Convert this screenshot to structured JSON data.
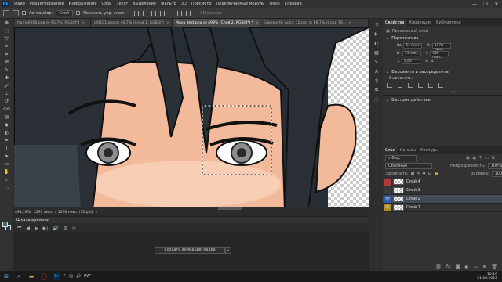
{
  "app": {
    "logo": "Ps"
  },
  "menu": [
    "Файл",
    "Редактирование",
    "Изображение",
    "Слои",
    "Текст",
    "Выделение",
    "Фильтр",
    "3D",
    "Просмотр",
    "Подключаемые модули",
    "Окно",
    "Справка"
  ],
  "window_controls": [
    "—",
    "❐",
    "✕"
  ],
  "options": {
    "autoselect_label": "Автовыбор:",
    "autoselect_value": "Слой",
    "show_controls_label": "Показать упр. элем.",
    "mode_3d": "3D-режим:"
  },
  "tabs": [
    {
      "label": "frame0000.png @ 66,7% (RGB/8*)",
      "close": "×",
      "active": false
    },
    {
      "label": "pl0101.png @ 46,7% (Слой 1, RGB/8*)",
      "close": "×",
      "active": false
    },
    {
      "label": "Maya_test.png @ 498% (Слой 2, RGB/8*) *",
      "close": "×",
      "active": true
    },
    {
      "label": "Edgeworth_point_c2.psd @ 66,7% (Слой 19...",
      "close": "×",
      "active": false
    }
  ],
  "status": {
    "zoom": "498,18%",
    "size": "2293 пикс. x 1290 пикс. (72 ppi)",
    "arrow": "›"
  },
  "timeline": {
    "title": "Шкала времени",
    "create_button": "Создать анимацию кадра",
    "dropdown": "⌄",
    "controls": [
      "⏮",
      "◀",
      "▶",
      "▶|",
      "🔊",
      "⚙",
      "✂"
    ]
  },
  "properties": {
    "tabs": [
      "Свойства",
      "Коррекция",
      "Библиотеки"
    ],
    "pixel_layer": "Пиксельный слой",
    "transform_title": "Перспектива",
    "w_label": "Ш:",
    "w_value": "54 пикс.",
    "h_label": "В:",
    "h_value": "54 пикс.",
    "x_label": "X:",
    "x_value": "1178 пикс.",
    "y_label": "Y:",
    "y_value": "480 пикс.",
    "angle_value": "0,00°",
    "align_title": "Выровнять и распределить",
    "align_label": "Выровнять:",
    "quick_title": "Быстрые действия",
    "more": "..."
  },
  "layers": {
    "tabs": [
      "Слои",
      "Каналы",
      "Контуры"
    ],
    "filter": "Вид",
    "blend": "Обычные",
    "opacity_label": "Непрозрачность:",
    "opacity": "100%",
    "lock_label": "Закрепить:",
    "fill_label": "Заливка:",
    "fill": "100%",
    "items": [
      {
        "name": "Слой 4",
        "eye": "",
        "selected": false,
        "eye_color": "#b03a3a"
      },
      {
        "name": "Слой 3",
        "eye": "",
        "selected": false,
        "eye_color": "#3a3a3a"
      },
      {
        "name": "Слой 2",
        "eye": "👁",
        "selected": true,
        "eye_color": "#2d5aa8"
      },
      {
        "name": "Слой 1",
        "eye": "👁",
        "selected": false,
        "eye_color": "#b08a1a"
      }
    ]
  },
  "taskbar": {
    "start": "⊞",
    "search": "⌕",
    "ps": "Ps",
    "lang": "РУС",
    "time": "10:10",
    "date": "21.06.2023"
  },
  "colors": {
    "accent": "#31a8ff",
    "skin": "#f2b99a",
    "hair": "#2b3036",
    "selected_layer": "#434a55"
  }
}
